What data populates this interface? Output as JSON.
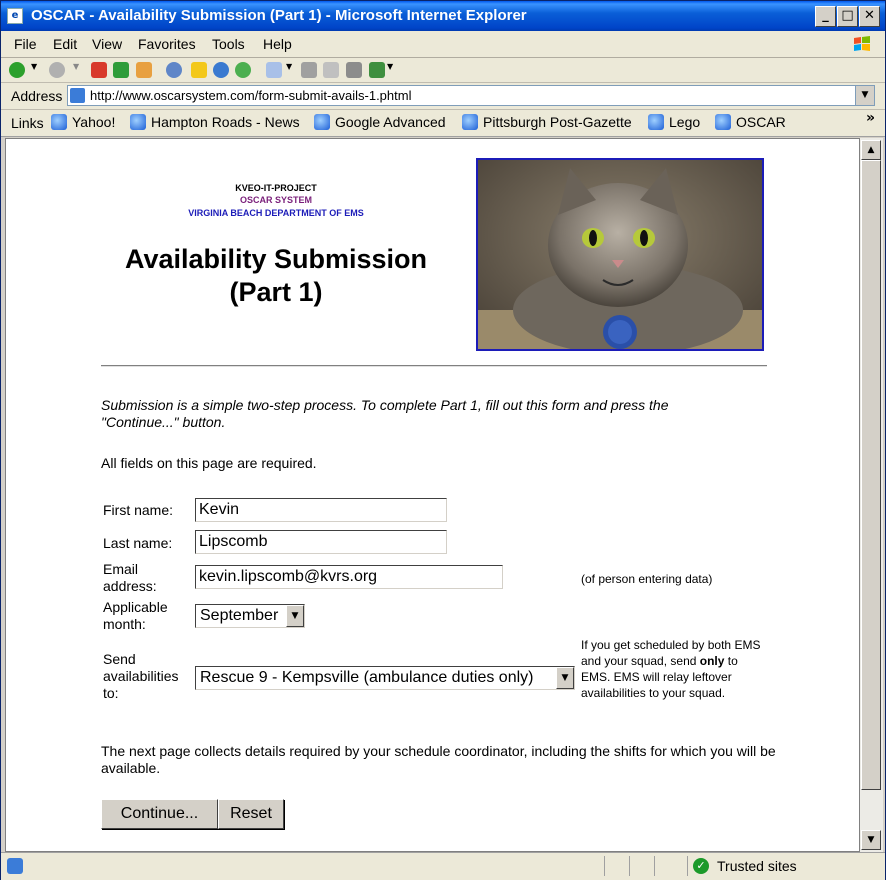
{
  "window": {
    "title": "OSCAR - Availability Submission (Part 1) - Microsoft Internet Explorer"
  },
  "menu": [
    "File",
    "Edit",
    "View",
    "Favorites",
    "Tools",
    "Help"
  ],
  "address": {
    "label": "Address",
    "url": "http://www.oscarsystem.com/form-submit-avails-1.phtml"
  },
  "links": {
    "label": "Links",
    "items": [
      "Yahoo!",
      "Hampton Roads - News",
      "Google Advanced",
      "Pittsburgh Post-Gazette",
      "Lego",
      "OSCAR"
    ]
  },
  "page": {
    "org_line1": "KVEO-IT-PROJECT",
    "org_line2": "OSCAR SYSTEM",
    "org_line3": "VIRGINIA BEACH DEPARTMENT OF EMS",
    "title_line1": "Availability Submission",
    "title_line2": "(Part 1)",
    "intro": "Submission is a simple two-step process.  To complete Part 1, fill out this form and press the \"Continue...\" button.",
    "required_note": "All fields on this page are required.",
    "fields": {
      "first_name_label": "First name:",
      "first_name_value": "Kevin",
      "last_name_label": "Last name:",
      "last_name_value": "Lipscomb",
      "email_label_1": "Email",
      "email_label_2": "address:",
      "email_value": "kevin.lipscomb@kvrs.org",
      "email_note": "(of person entering data)",
      "month_label_1": "Applicable",
      "month_label_2": "month:",
      "month_value": "September",
      "send_label_1": "Send",
      "send_label_2": "availabilities",
      "send_label_3": "to:",
      "send_value": "Rescue 9 - Kempsville (ambulance duties only)",
      "send_note_pre": "If you get scheduled by both EMS and your squad, send ",
      "send_note_bold": "only",
      "send_note_post": " to EMS.  EMS will relay leftover availabilities to your squad."
    },
    "next_note": "The next page collects details required by your schedule coordinator, including the shifts for which you will be available.",
    "continue_button": "Continue...",
    "reset_button": "Reset"
  },
  "status": {
    "zone": "Trusted sites"
  },
  "colors": {
    "titlebar": "#0a5fd8",
    "org_line2": "#7a1f7a",
    "org_line3": "#1c1cb8",
    "photo_border": "#1c1cb8"
  }
}
